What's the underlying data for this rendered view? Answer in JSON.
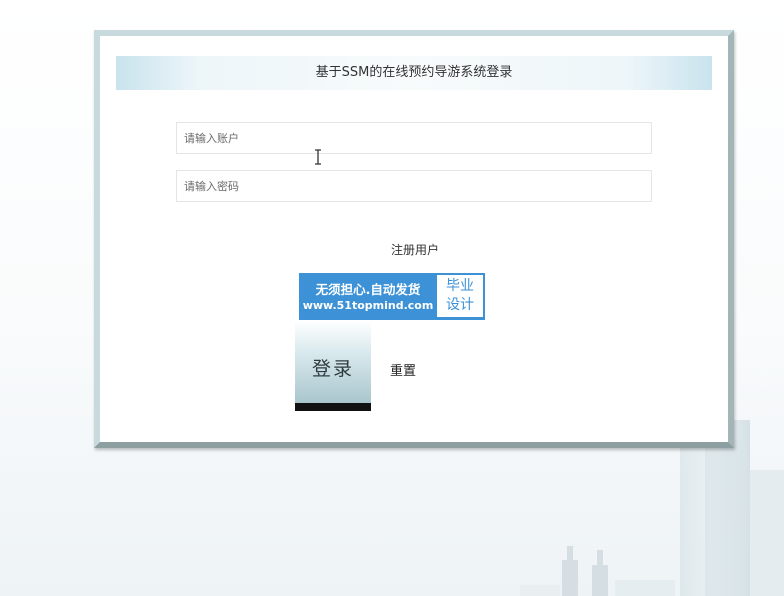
{
  "login": {
    "title": "基于SSM的在线预约导游系统登录",
    "account_placeholder": "请输入账户",
    "account_value": "",
    "password_placeholder": "请输入密码",
    "password_value": "",
    "register_label": "注册用户",
    "login_label": "登录",
    "reset_label": "重置"
  },
  "promo": {
    "line1": "无须担心.自动发货",
    "line2": "www.51topmind.com",
    "badge_line1": "毕业",
    "badge_line2": "设计"
  },
  "colors": {
    "promo_blue": "#3d92d7",
    "card_border": "#c8dadd",
    "title_bar": "#c9e3ee"
  }
}
